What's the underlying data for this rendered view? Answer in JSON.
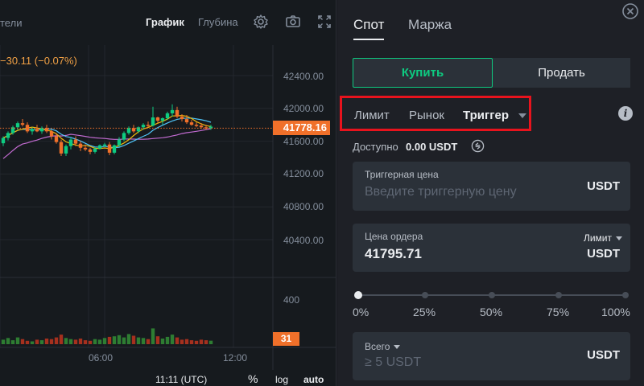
{
  "chart": {
    "top_left_text": "тели",
    "tabs": {
      "chart": "График",
      "depth": "Глубина"
    },
    "change_text": "−30.11 (−0.07%)",
    "price_axis": [
      "42400.00",
      "42000.00",
      "41600.00",
      "41200.00",
      "40800.00",
      "40400.00"
    ],
    "last_price": "41778.16",
    "volume_axis": "400",
    "volume_last": "31",
    "time_axis": [
      "06:00",
      "12:00"
    ],
    "bottom": {
      "time": "11:11 (UTC)",
      "percent": "%",
      "log": "log",
      "auto": "auto"
    },
    "colors": {
      "up": "#0ecb81",
      "down": "#f6465d",
      "accent": "#f0702a",
      "ma_yellow": "#f0b90b",
      "ma_cyan": "#4fc3f7",
      "ma_purple": "#c26bd1"
    },
    "candles": [
      {
        "o": 41575,
        "h": 41660,
        "l": 41540,
        "c": 41640
      },
      {
        "o": 41640,
        "h": 41720,
        "l": 41610,
        "c": 41700
      },
      {
        "o": 41700,
        "h": 41790,
        "l": 41680,
        "c": 41770
      },
      {
        "o": 41770,
        "h": 41840,
        "l": 41740,
        "c": 41820
      },
      {
        "o": 41820,
        "h": 41870,
        "l": 41780,
        "c": 41800
      },
      {
        "o": 41800,
        "h": 41830,
        "l": 41700,
        "c": 41720
      },
      {
        "o": 41720,
        "h": 41770,
        "l": 41680,
        "c": 41750
      },
      {
        "o": 41750,
        "h": 41800,
        "l": 41710,
        "c": 41720
      },
      {
        "o": 41720,
        "h": 41780,
        "l": 41690,
        "c": 41760
      },
      {
        "o": 41760,
        "h": 41800,
        "l": 41700,
        "c": 41720
      },
      {
        "o": 41720,
        "h": 41740,
        "l": 41620,
        "c": 41660
      },
      {
        "o": 41660,
        "h": 41700,
        "l": 41570,
        "c": 41590
      },
      {
        "o": 41590,
        "h": 41620,
        "l": 41420,
        "c": 41450
      },
      {
        "o": 41450,
        "h": 41560,
        "l": 41420,
        "c": 41540
      },
      {
        "o": 41540,
        "h": 41640,
        "l": 41500,
        "c": 41620
      },
      {
        "o": 41620,
        "h": 41660,
        "l": 41540,
        "c": 41570
      },
      {
        "o": 41570,
        "h": 41600,
        "l": 41480,
        "c": 41520
      },
      {
        "o": 41520,
        "h": 41560,
        "l": 41480,
        "c": 41500
      },
      {
        "o": 41500,
        "h": 41520,
        "l": 41440,
        "c": 41470
      },
      {
        "o": 41470,
        "h": 41530,
        "l": 41450,
        "c": 41510
      },
      {
        "o": 41510,
        "h": 41560,
        "l": 41500,
        "c": 41550
      },
      {
        "o": 41550,
        "h": 41580,
        "l": 41530,
        "c": 41560
      },
      {
        "o": 41560,
        "h": 41590,
        "l": 41430,
        "c": 41460
      },
      {
        "o": 41460,
        "h": 41560,
        "l": 41440,
        "c": 41550
      },
      {
        "o": 41550,
        "h": 41650,
        "l": 41530,
        "c": 41620
      },
      {
        "o": 41620,
        "h": 41720,
        "l": 41600,
        "c": 41700
      },
      {
        "o": 41700,
        "h": 41780,
        "l": 41680,
        "c": 41760
      },
      {
        "o": 41760,
        "h": 41800,
        "l": 41700,
        "c": 41720
      },
      {
        "o": 41720,
        "h": 41780,
        "l": 41700,
        "c": 41770
      },
      {
        "o": 41770,
        "h": 41820,
        "l": 41740,
        "c": 41800
      },
      {
        "o": 41800,
        "h": 41840,
        "l": 41770,
        "c": 41790
      },
      {
        "o": 41790,
        "h": 42020,
        "l": 41780,
        "c": 41890
      },
      {
        "o": 41890,
        "h": 41900,
        "l": 41820,
        "c": 41850
      },
      {
        "o": 41850,
        "h": 41890,
        "l": 41800,
        "c": 41880
      },
      {
        "o": 41880,
        "h": 41960,
        "l": 41860,
        "c": 41940
      },
      {
        "o": 41940,
        "h": 42050,
        "l": 41900,
        "c": 41980
      },
      {
        "o": 41980,
        "h": 42020,
        "l": 41880,
        "c": 41900
      },
      {
        "o": 41900,
        "h": 41930,
        "l": 41840,
        "c": 41870
      },
      {
        "o": 41870,
        "h": 41920,
        "l": 41810,
        "c": 41830
      },
      {
        "o": 41830,
        "h": 41860,
        "l": 41790,
        "c": 41800
      },
      {
        "o": 41800,
        "h": 41830,
        "l": 41770,
        "c": 41790
      },
      {
        "o": 41790,
        "h": 41820,
        "l": 41750,
        "c": 41770
      },
      {
        "o": 41770,
        "h": 41800,
        "l": 41740,
        "c": 41760
      },
      {
        "o": 41760,
        "h": 41800,
        "l": 41740,
        "c": 41778
      }
    ],
    "volumes": [
      40,
      55,
      35,
      60,
      45,
      30,
      25,
      40,
      35,
      50,
      45,
      60,
      85,
      55,
      45,
      40,
      50,
      35,
      30,
      45,
      40,
      55,
      65,
      70,
      80,
      60,
      90,
      75,
      60,
      55,
      45,
      140,
      70,
      50,
      65,
      85,
      60,
      40,
      45,
      35,
      30,
      40,
      35,
      31
    ]
  },
  "trade": {
    "tabs": {
      "spot": "Спот",
      "margin": "Маржа"
    },
    "buy": "Купить",
    "sell": "Продать",
    "order_types": {
      "limit": "Лимит",
      "market": "Рынок",
      "trigger": "Триггер"
    },
    "available_label": "Доступно",
    "available_value": "0.00 USDT",
    "trigger_field": {
      "label": "Триггерная цена",
      "placeholder": "Введите триггерную цену",
      "unit": "USDT"
    },
    "order_field": {
      "label": "Цена ордера",
      "value": "41795.71",
      "unit": "USDT",
      "mode": "Лимит"
    },
    "slider": {
      "value": 0,
      "labels": [
        "0%",
        "25%",
        "50%",
        "75%",
        "100%"
      ]
    },
    "total_field": {
      "label": "Всего",
      "placeholder": "≥ 5 USDT",
      "unit": "USDT"
    }
  }
}
